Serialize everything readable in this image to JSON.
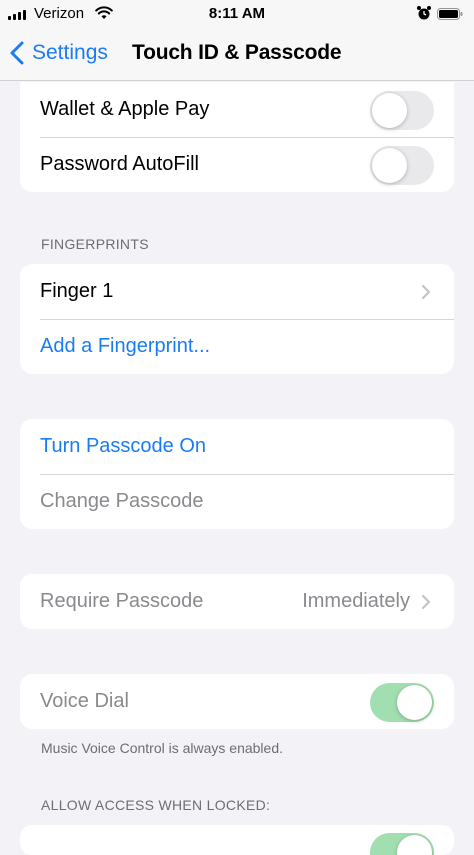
{
  "status_bar": {
    "carrier": "Verizon",
    "time": "8:11 AM",
    "icons": [
      "signal-icon",
      "wifi-icon",
      "alarm-icon",
      "battery-icon"
    ]
  },
  "nav": {
    "back_label": "Settings",
    "title": "Touch ID & Passcode"
  },
  "use_touch_id_for": {
    "rows": [
      {
        "label": "Wallet & Apple Pay",
        "toggle_on": false
      },
      {
        "label": "Password AutoFill",
        "toggle_on": false
      }
    ]
  },
  "fingerprints": {
    "header": "FINGERPRINTS",
    "finger_1": "Finger 1",
    "add": "Add a Fingerprint..."
  },
  "passcode": {
    "turn_on": "Turn Passcode On",
    "change": "Change Passcode"
  },
  "require": {
    "label": "Require Passcode",
    "value": "Immediately"
  },
  "voice_dial": {
    "label": "Voice Dial",
    "toggle_on": true,
    "footer": "Music Voice Control is always enabled."
  },
  "locked": {
    "header": "ALLOW ACCESS WHEN LOCKED:"
  },
  "colors": {
    "accent": "#1a7cf5",
    "toggle_on": "#a2dfb0",
    "toggle_off": "#e9e9eb",
    "background": "#f2f2f7"
  }
}
